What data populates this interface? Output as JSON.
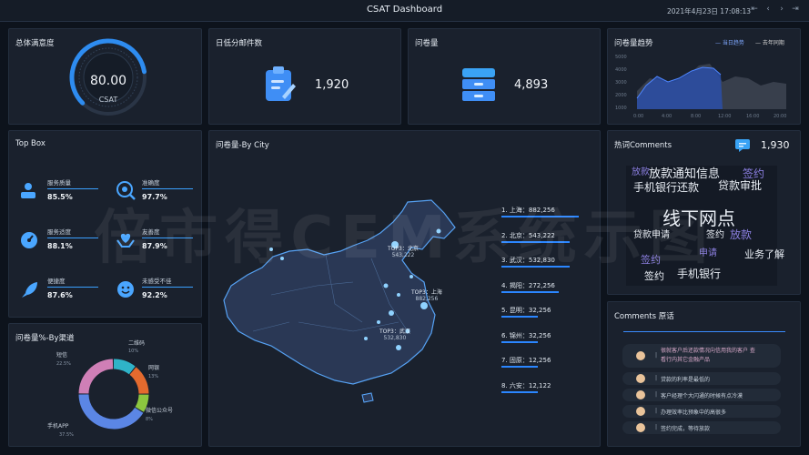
{
  "header": {
    "title": "CSAT  Dashboard",
    "datetime": "2021年4月23日 17:08:13",
    "nav_prev": "⇤",
    "nav_back": "‹",
    "nav_next": "›",
    "nav_end": "⇥"
  },
  "satisfaction": {
    "title": "总体满意度",
    "value": "80.00",
    "label": "CSAT",
    "gauge_fraction": 0.8
  },
  "low_score": {
    "title": "日低分邮件数",
    "value": "1,920",
    "icon": "clipboard-icon"
  },
  "surveys": {
    "title": "问卷量",
    "value": "4,893",
    "icon": "cabinet-icon"
  },
  "trend": {
    "title": "问卷量趋势",
    "legend_current": "当日趋势",
    "legend_last": "去年同期",
    "colors": {
      "current": "#3b6fe0",
      "last": "#b0b0b0"
    },
    "y_ticks": [
      "5000",
      "4000",
      "3000",
      "2000",
      "1000"
    ],
    "x_ticks": [
      "0:00",
      "4:00",
      "8:00",
      "12:00",
      "16:00",
      "20:00"
    ]
  },
  "topbox": {
    "title": "Top Box",
    "metrics": [
      {
        "label": "服务质量",
        "value": "85.5%",
        "icon": "person-icon",
        "fraction": 0.855
      },
      {
        "label": "准确度",
        "value": "97.7%",
        "icon": "target-icon",
        "fraction": 0.977
      },
      {
        "label": "服务适度",
        "value": "88.1%",
        "icon": "speedometer-icon",
        "fraction": 0.881
      },
      {
        "label": "友善度",
        "value": "87.9%",
        "icon": "heart-hands-icon",
        "fraction": 0.879
      },
      {
        "label": "便捷度",
        "value": "87.6%",
        "icon": "rocket-icon",
        "fraction": 0.876
      },
      {
        "label": "未感受不佳",
        "value": "92.2%",
        "icon": "smile-icon",
        "fraction": 0.922
      }
    ]
  },
  "city": {
    "title": "问卷量-By City",
    "callouts": [
      {
        "name": "TOP3：北京",
        "value": "543,222"
      },
      {
        "name": "TOP3：上海",
        "value": "882,256"
      },
      {
        "name": "TOP3：武汉",
        "value": "532,830"
      }
    ],
    "ranking": [
      {
        "label": "1. 上海：882,256",
        "value": 882256
      },
      {
        "label": "2. 北京：543,222",
        "value": 543222
      },
      {
        "label": "3. 武汉：532,830",
        "value": 532830
      },
      {
        "label": "4. 揭阳：272,256",
        "value": 272256
      },
      {
        "label": "5. 昆明：32,256",
        "value": 32256
      },
      {
        "label": "6. 锦州：32,256",
        "value": 32256
      },
      {
        "label": "7. 固原：12,256",
        "value": 12256
      },
      {
        "label": "8. 六安：12,122",
        "value": 12122
      }
    ]
  },
  "channel": {
    "title": "问卷量%-By渠道",
    "slices": [
      {
        "name": "二维码",
        "pct": "10%",
        "value": 10,
        "color": "#2fb3c8"
      },
      {
        "name": "网银",
        "pct": "13%",
        "value": 13,
        "color": "#e46a2e"
      },
      {
        "name": "微信公众号",
        "pct": "8%",
        "value": 8,
        "color": "#8cc63f"
      },
      {
        "name": "手机APP",
        "pct": "37.5%",
        "value": 37.5,
        "color": "#5b86e5"
      },
      {
        "name": "短信",
        "pct": "22.5%",
        "value": 22.5,
        "color": "#cf7fb6"
      }
    ]
  },
  "hotwords": {
    "title": "热词Comments",
    "count": "1,930",
    "words": [
      {
        "t": "放款通知信息",
        "c": "#e9eef5"
      },
      {
        "t": "签约",
        "c": "#8b7fe0"
      },
      {
        "t": "放款",
        "c": "#8b7fe0"
      },
      {
        "t": "手机银行还款",
        "c": "#e9eef5"
      },
      {
        "t": "贷款审批",
        "c": "#e9eef5"
      },
      {
        "t": "线下网点",
        "c": "#e9eef5"
      },
      {
        "t": "放款",
        "c": "#8b7fe0"
      },
      {
        "t": "签约",
        "c": "#e9eef5"
      },
      {
        "t": "手机银行",
        "c": "#e9eef5"
      },
      {
        "t": "签约",
        "c": "#e9eef5"
      },
      {
        "t": "签约",
        "c": "#8b7fe0"
      },
      {
        "t": "贷款申请",
        "c": "#e9eef5"
      },
      {
        "t": "业务了解",
        "c": "#e9eef5"
      },
      {
        "t": "申请",
        "c": "#8b7fe0"
      }
    ]
  },
  "comments": {
    "title": "Comments 原话",
    "items": [
      "很就客户后还款情况向信用我的客户 查看行内其它金融产品",
      "贷款的利率是最低的",
      "客户经理个大闪通的时候有点冷漠",
      "办理效率比预象中的高很多",
      "签约完成，等待放款"
    ]
  },
  "watermark": "倍市得CEM系统示图"
}
